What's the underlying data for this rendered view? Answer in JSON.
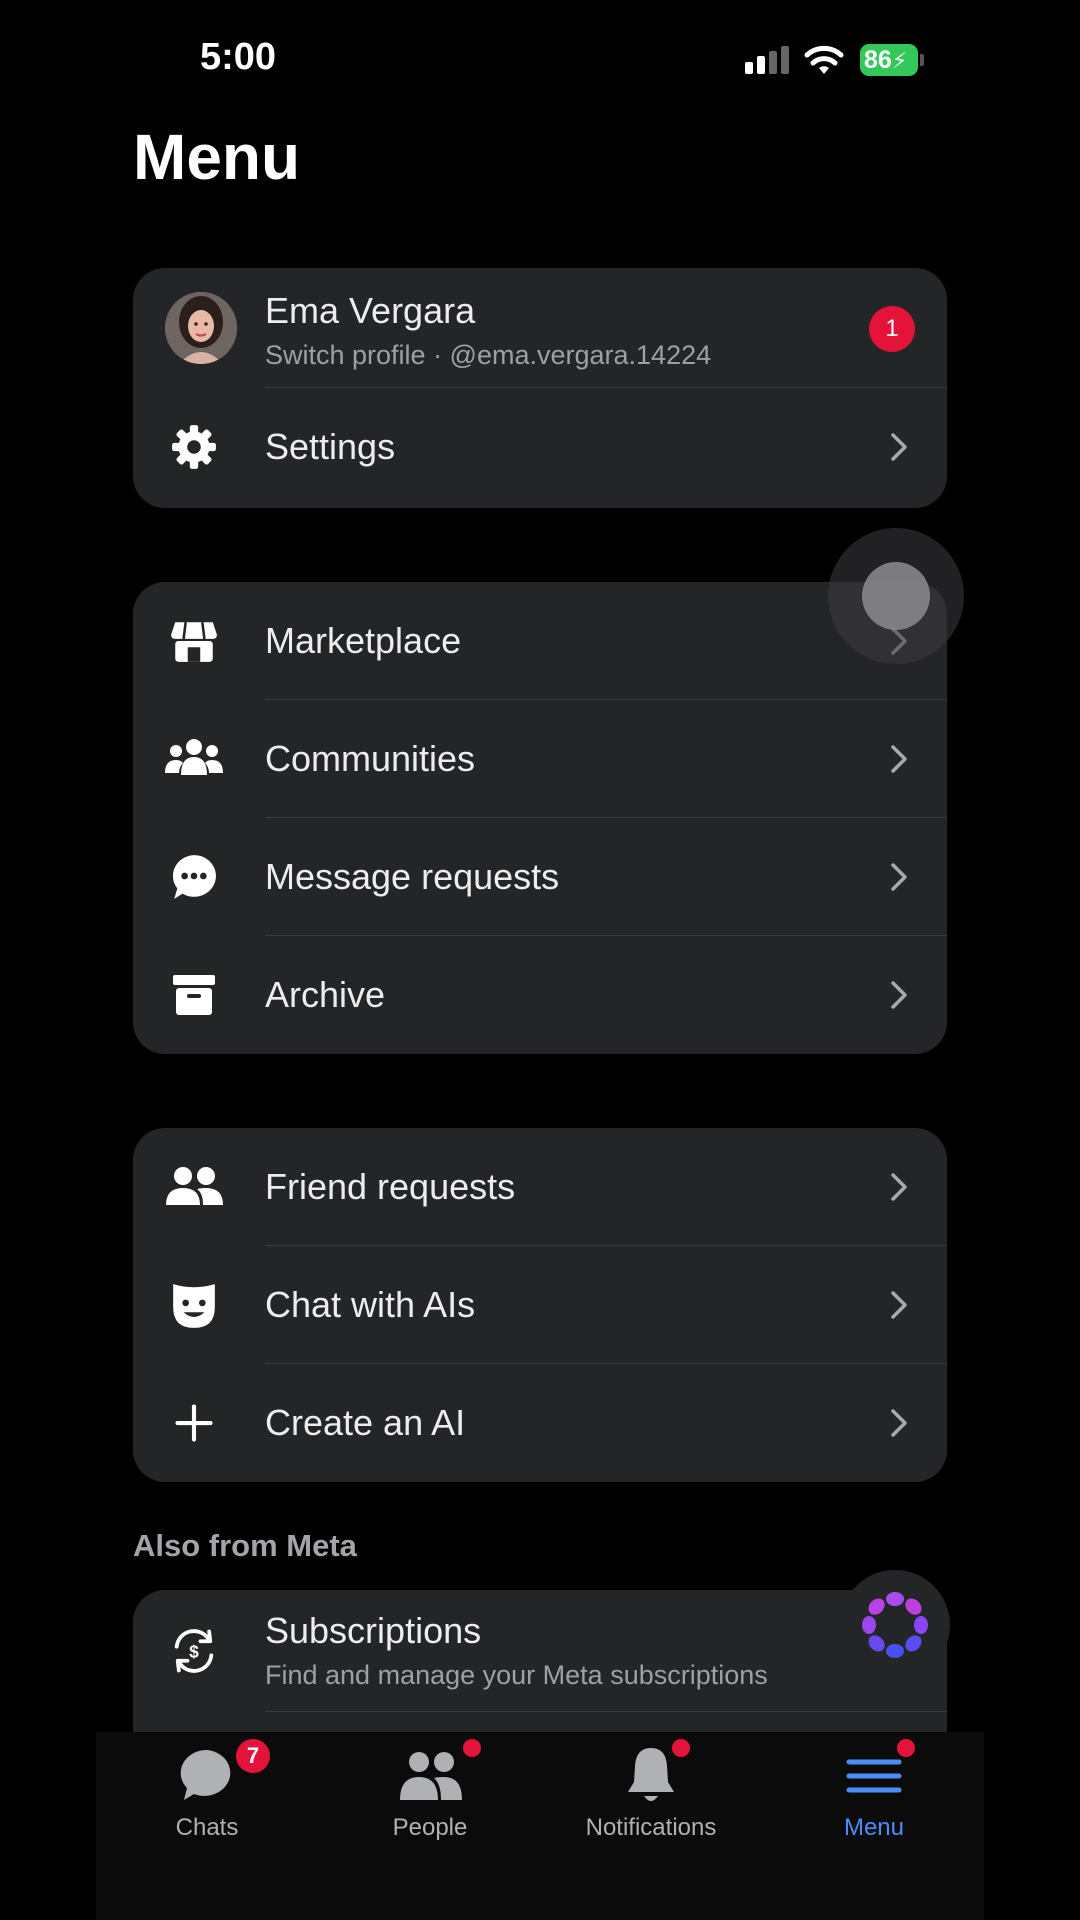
{
  "status_bar": {
    "time": "5:00",
    "battery": "86"
  },
  "page_title": "Menu",
  "profile": {
    "name": "Ema Vergara",
    "subtitle": "Switch profile · @ema.vergara.14224",
    "badge_count": "1"
  },
  "card1": {
    "settings_label": "Settings"
  },
  "card2": {
    "items": [
      {
        "label": "Marketplace",
        "icon": "store-icon"
      },
      {
        "label": "Communities",
        "icon": "communities-icon"
      },
      {
        "label": "Message requests",
        "icon": "chat-bubble-dots-icon"
      },
      {
        "label": "Archive",
        "icon": "archive-box-icon"
      }
    ]
  },
  "card3": {
    "items": [
      {
        "label": "Friend requests",
        "icon": "friends-icon"
      },
      {
        "label": "Chat with AIs",
        "icon": "ai-face-icon"
      },
      {
        "label": "Create an AI",
        "icon": "plus-icon"
      }
    ]
  },
  "also_from_meta": {
    "header": "Also from Meta",
    "subscriptions_title": "Subscriptions",
    "subscriptions_desc": "Find and manage your Meta subscriptions"
  },
  "tab_bar": {
    "tabs": [
      {
        "label": "Chats",
        "badge": "7",
        "active": false
      },
      {
        "label": "People",
        "active": false
      },
      {
        "label": "Notifications",
        "active": false
      },
      {
        "label": "Menu",
        "active": true
      }
    ]
  },
  "colors": {
    "accent": "#4a8df8",
    "badge_red": "#e4133a",
    "card_bg": "#242527",
    "battery_green": "#34c759"
  }
}
